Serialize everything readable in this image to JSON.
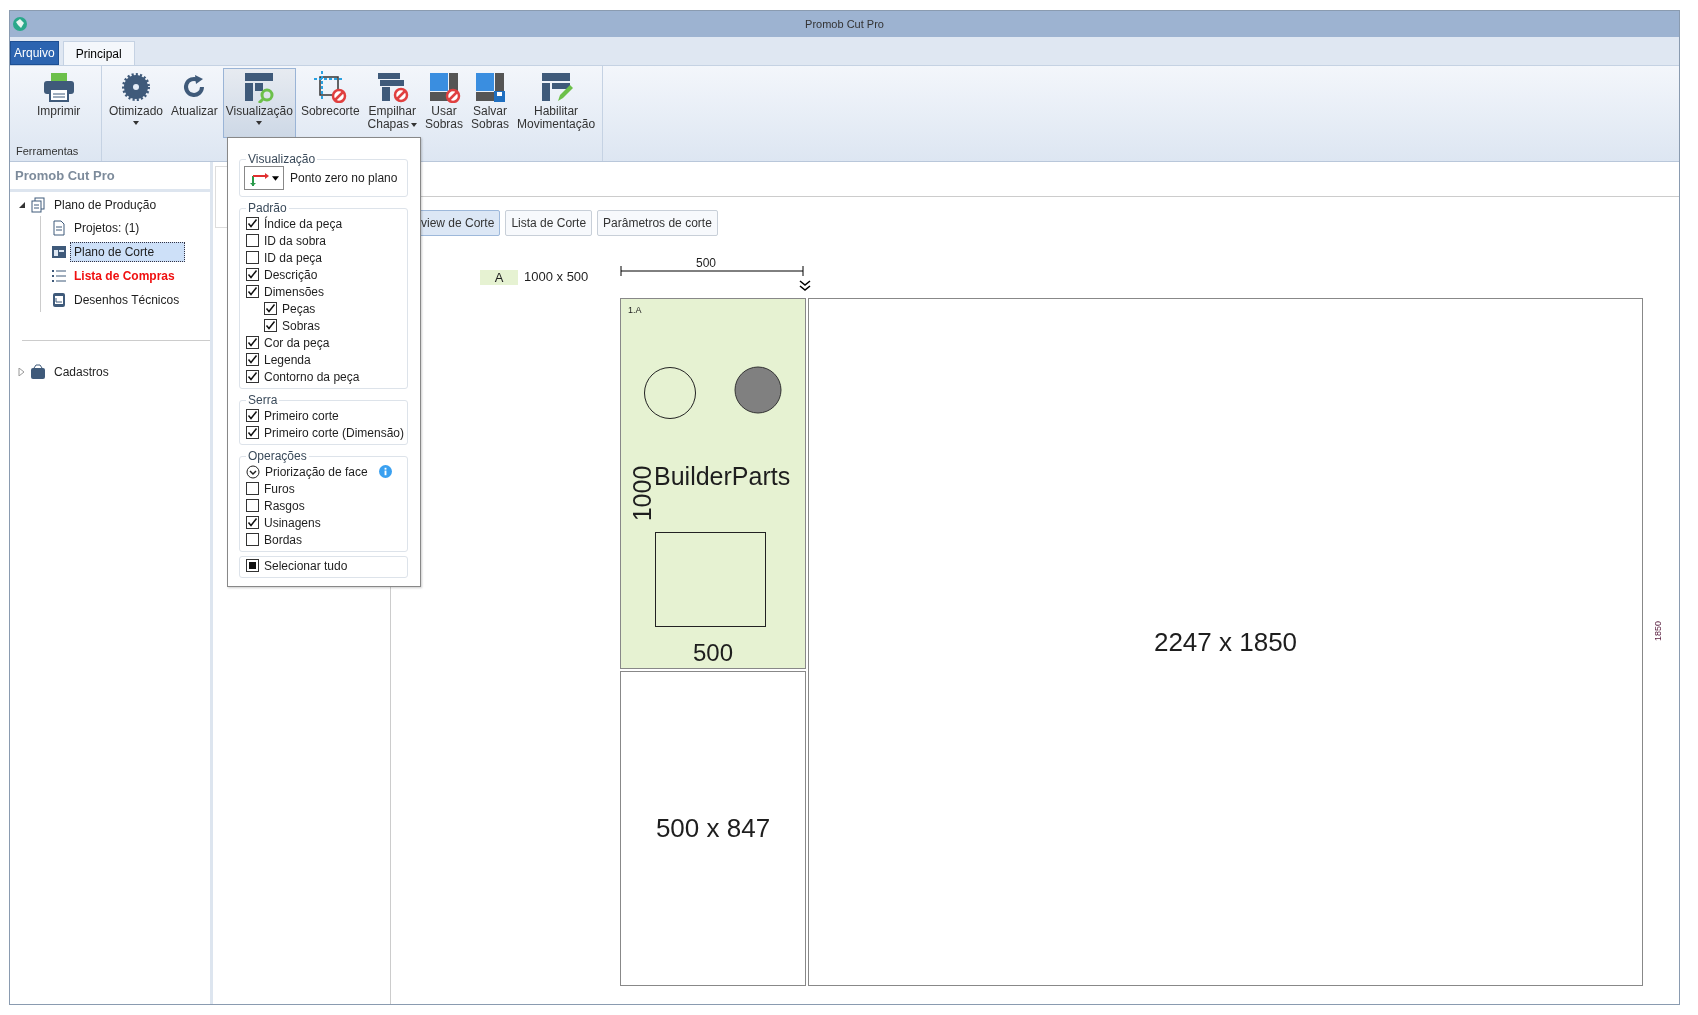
{
  "window": {
    "title": "Promob Cut Pro"
  },
  "app_menu": {
    "label": "Arquivo"
  },
  "ribbon_tabs": [
    {
      "label": "Principal",
      "selected": true
    }
  ],
  "ribbon_groups": [
    {
      "label": "Ferramentas",
      "buttons": [
        {
          "lines": [
            "Imprimir"
          ],
          "dropdown": false,
          "pressed": false
        }
      ]
    },
    {
      "buttons": [
        {
          "lines": [
            "Otimizado"
          ],
          "dropdown": true,
          "pressed": false
        },
        {
          "lines": [
            "Atualizar"
          ],
          "dropdown": false,
          "pressed": false
        },
        {
          "lines": [
            "Visualização"
          ],
          "dropdown": true,
          "pressed": true
        },
        {
          "lines": [
            "Sobrecorte"
          ],
          "dropdown": false,
          "pressed": false
        },
        {
          "lines": [
            "Empilhar",
            "Chapas"
          ],
          "dropdown": true,
          "pressed": false
        },
        {
          "lines": [
            "Usar",
            "Sobras"
          ],
          "dropdown": false,
          "pressed": false
        },
        {
          "lines": [
            "Salvar",
            "Sobras"
          ],
          "dropdown": false,
          "pressed": false
        },
        {
          "lines": [
            "Habilitar",
            "Movimentação"
          ],
          "dropdown": false,
          "pressed": false
        }
      ]
    }
  ],
  "sidebar": {
    "title": "Promob Cut Pro",
    "tree": [
      {
        "label": "Plano de Produção",
        "expanded": true,
        "selected": false,
        "emphasized": false,
        "children": [
          {
            "label": "Projetos: (1)",
            "selected": false,
            "emphasized": false
          },
          {
            "label": "Plano de Corte",
            "selected": true,
            "emphasized": false
          },
          {
            "label": "Lista de Compras",
            "selected": false,
            "emphasized": true
          },
          {
            "label": "Desenhos Técnicos",
            "selected": false,
            "emphasized": false
          }
        ]
      },
      {
        "label": "Cadastros",
        "expanded": false,
        "selected": false,
        "emphasized": false
      }
    ]
  },
  "view_menu": {
    "sections": [
      {
        "title": "Visualização",
        "items": [
          {
            "kind": "combo",
            "label": "Ponto zero no plano"
          }
        ]
      },
      {
        "title": "Padrão",
        "items": [
          {
            "kind": "check",
            "label": "Índice da peça",
            "checked": true
          },
          {
            "kind": "check",
            "label": "ID da sobra",
            "checked": false
          },
          {
            "kind": "check",
            "label": "ID da peça",
            "checked": false
          },
          {
            "kind": "check",
            "label": "Descrição",
            "checked": true
          },
          {
            "kind": "check",
            "label": "Dimensões",
            "checked": true,
            "children": [
              {
                "kind": "check",
                "label": "Peças",
                "checked": true
              },
              {
                "kind": "check",
                "label": "Sobras",
                "checked": true
              }
            ]
          },
          {
            "kind": "check",
            "label": "Cor da peça",
            "checked": true
          },
          {
            "kind": "check",
            "label": "Legenda",
            "checked": true
          },
          {
            "kind": "check",
            "label": "Contorno da peça",
            "checked": true
          }
        ]
      },
      {
        "title": "Serra",
        "items": [
          {
            "kind": "check",
            "label": "Primeiro corte",
            "checked": true
          },
          {
            "kind": "check",
            "label": "Primeiro corte (Dimensão)",
            "checked": true
          }
        ]
      },
      {
        "title": "Operações",
        "items": [
          {
            "kind": "toggle",
            "label": "Priorização de face",
            "checked": true,
            "info": true
          },
          {
            "kind": "check",
            "label": "Furos",
            "checked": false
          },
          {
            "kind": "check",
            "label": "Rasgos",
            "checked": false
          },
          {
            "kind": "check",
            "label": "Usinagens",
            "checked": true
          },
          {
            "kind": "check",
            "label": "Bordas",
            "checked": false
          }
        ]
      },
      {
        "items": [
          {
            "kind": "select-all",
            "label": "Selecionar tudo",
            "indeterminate": true
          }
        ]
      }
    ]
  },
  "content_tabs": [
    {
      "label": "view de Corte",
      "selected": true
    },
    {
      "label": "Lista de Corte",
      "selected": false
    },
    {
      "label": "Parâmetros de corte",
      "selected": false
    }
  ],
  "plan": {
    "sheet_label": "A",
    "sheet_size": "1000 x 500",
    "top_dimension": "500",
    "piece": {
      "id": "1.A",
      "description": "BuilderParts",
      "height_label": "1000",
      "width_label": "500",
      "color": "#e6f2d2"
    },
    "leftovers": [
      {
        "label": "500 x 847"
      },
      {
        "label": "2247 x 1850",
        "side_dimension": "1850"
      }
    ]
  }
}
